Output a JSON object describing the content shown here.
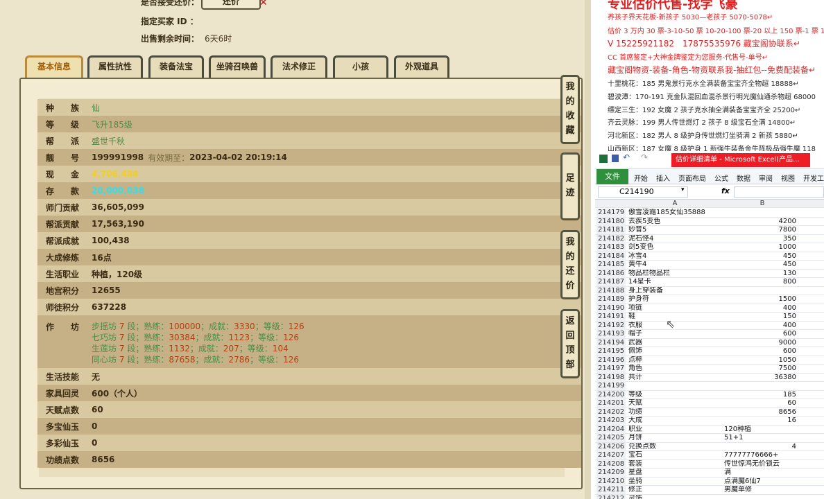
{
  "game": {
    "top": {
      "accept_counter_label": "是否接受还价：",
      "counter_button": "还价",
      "buyer_id_label": "指定买家 ID ：",
      "time_left_label": "出售剩余时间：",
      "time_left_value": "6天6时"
    },
    "tabs": [
      {
        "label": "基本信息",
        "active": true
      },
      {
        "label": "属性抗性",
        "active": false
      },
      {
        "label": "装备法宝",
        "active": false
      },
      {
        "label": "坐骑召唤兽",
        "active": false
      },
      {
        "label": "法术修正",
        "active": false
      },
      {
        "label": "小孩",
        "active": false
      },
      {
        "label": "外观道具",
        "active": false
      }
    ],
    "rows": [
      {
        "label": "种　　族",
        "value": "仙",
        "style": "g"
      },
      {
        "label": "等　　级",
        "value": "飞升185级",
        "style": "g"
      },
      {
        "label": "帮　　派",
        "value": "盛世千秋",
        "style": "g"
      },
      {
        "label": "靓　　号",
        "value": "199991998",
        "extra_label": "有效期至：",
        "extra_value": "2023-04-02 20:19:14",
        "style": ""
      },
      {
        "label": "现　　金",
        "value": "4,706,488",
        "style": "y"
      },
      {
        "label": "存　　款",
        "value": "20,000,038",
        "style": "c"
      },
      {
        "label": "师门贡献",
        "value": "36,605,099",
        "style": ""
      },
      {
        "label": "帮派贡献",
        "value": "17,563,190",
        "style": ""
      },
      {
        "label": "帮派成就",
        "value": "100,438",
        "style": ""
      },
      {
        "label": "大成修炼",
        "value": "16点",
        "style": ""
      },
      {
        "label": "生活职业",
        "value": "种植，120级",
        "style": ""
      },
      {
        "label": "地宫积分",
        "value": "12655",
        "style": ""
      },
      {
        "label": "师徒积分",
        "value": "637228",
        "style": ""
      }
    ],
    "workshop": {
      "label": "作　　坊",
      "lines": [
        {
          "name": "步摇坊",
          "grade": "7",
          "skill": "100000",
          "ach": "3330",
          "lvl": "126"
        },
        {
          "name": "七巧坊",
          "grade": "7",
          "skill": "30384",
          "ach": "1123",
          "lvl": "126"
        },
        {
          "name": "生莲坊",
          "grade": "7",
          "skill": "1132",
          "ach": "207",
          "lvl": "104"
        },
        {
          "name": "同心坊",
          "grade": "7",
          "skill": "87658",
          "ach": "2786",
          "lvl": "126"
        }
      ],
      "grade_word": "段；熟练：",
      "ach_word": "；成就：",
      "lvl_word": "；等级："
    },
    "rows2": [
      {
        "label": "生活技能",
        "value": "无"
      },
      {
        "label": "家具回灵",
        "value": "600（个人）"
      },
      {
        "label": "天赋点数",
        "value": "60"
      },
      {
        "label": "多宝仙玉",
        "value": "0"
      },
      {
        "label": "多彩仙玉",
        "value": "0"
      },
      {
        "label": "功绩点数",
        "value": "8656"
      }
    ],
    "side_buttons": [
      "我的收藏",
      "足迹",
      "我的还价",
      "返回顶部"
    ]
  },
  "ad": {
    "headline": "专业估价代售-找学飞豪",
    "lines": [
      {
        "text": "养孩子界天花板-新孩子 5030—老孩子 5070-5078↵",
        "style": "red"
      },
      {
        "text": "估价 3 万内 30 票-3-10-50 票 10-20-100 票-20 以上 150 票-1 票 1",
        "style": "red"
      },
      {
        "text": "V 15225921182　17875535976  藏宝阁协联系↵",
        "style": "red big"
      },
      {
        "text": "CC 首席鉴定+大神金牌鉴定为您服务-代售号-单号↵",
        "style": "red"
      },
      {
        "text": "藏宝阁物资-装备-角色-物资联系我-抽红包--免费配装备↵",
        "style": "red big"
      },
      {
        "text": "十里桃花：185 男鬼景行克水全满装备宝宝齐全物超 18888↵",
        "style": ""
      },
      {
        "text": "碧波潭：170-191 克金队混回血混杀景行明光魔仙通杀物超 68000",
        "style": ""
      },
      {
        "text": "缥定三生：192 女魔 2 孩子克水抽全满装备宝宝齐全 25200↵",
        "style": ""
      },
      {
        "text": "齐云灵脉：199 男人传世燃灯 2 孩子 8 级宝石全满 14800↵",
        "style": ""
      },
      {
        "text": "河北新区：182 男人 8 级护身传世燃灯坐骑满 2 新孩 5880↵",
        "style": ""
      },
      {
        "text": "山西新区：187 女魔 8 级护身 1 新强牛装备金牛阵极品强牛魔 118",
        "style": ""
      }
    ]
  },
  "excel": {
    "title": "估价详细清单 - Microsoft Excel(产品...",
    "ribbon_tabs": [
      "文件",
      "开始",
      "插入",
      "页面布局",
      "公式",
      "数据",
      "审阅",
      "视图",
      "开发工"
    ],
    "name_box": "C214190",
    "fx": "fx",
    "col_a": "A",
    "col_b": "B",
    "rows": [
      {
        "n": "214179",
        "a": "傲雪凌霜185女仙35888",
        "b": ""
      },
      {
        "n": "214180",
        "a": "去疾5变色",
        "b": "4200",
        "num": true
      },
      {
        "n": "214181",
        "a": "妙音5",
        "b": "7800",
        "num": true
      },
      {
        "n": "214182",
        "a": "泥石怪4",
        "b": "350",
        "num": true
      },
      {
        "n": "214183",
        "a": "剑5变色",
        "b": "1000",
        "num": true
      },
      {
        "n": "214184",
        "a": "冰雪4",
        "b": "450",
        "num": true
      },
      {
        "n": "214185",
        "a": "黄牛4",
        "b": "450",
        "num": true
      },
      {
        "n": "214186",
        "a": "物品栏物品栏",
        "b": "130",
        "num": true
      },
      {
        "n": "214187",
        "a": "14星卡",
        "b": "800",
        "num": true
      },
      {
        "n": "214188",
        "a": "身上穿装备",
        "b": ""
      },
      {
        "n": "214189",
        "a": "护身符",
        "b": "1500",
        "num": true
      },
      {
        "n": "214190",
        "a": "项链",
        "b": "400",
        "num": true
      },
      {
        "n": "214191",
        "a": "鞋",
        "b": "150",
        "num": true
      },
      {
        "n": "214192",
        "a": "衣服",
        "b": "400",
        "num": true
      },
      {
        "n": "214193",
        "a": "帽子",
        "b": "600",
        "num": true
      },
      {
        "n": "214194",
        "a": "武器",
        "b": "9000",
        "num": true
      },
      {
        "n": "214195",
        "a": "佩饰",
        "b": "600",
        "num": true
      },
      {
        "n": "214196",
        "a": "点粹",
        "b": "1050",
        "num": true
      },
      {
        "n": "214197",
        "a": "角色",
        "b": "7500",
        "num": true
      },
      {
        "n": "214198",
        "a": "共计",
        "b": "36380",
        "num": true
      },
      {
        "n": "214199",
        "a": "",
        "b": ""
      },
      {
        "n": "214200",
        "a": "等级",
        "b": "185",
        "num": true
      },
      {
        "n": "214201",
        "a": "天赋",
        "b": "60",
        "num": true
      },
      {
        "n": "214202",
        "a": "功绩",
        "b": "8656",
        "num": true
      },
      {
        "n": "214203",
        "a": "大成",
        "b": "16",
        "num": true
      },
      {
        "n": "214204",
        "a": "职业",
        "b": "120种植"
      },
      {
        "n": "214205",
        "a": "月饼",
        "b": "51+1"
      },
      {
        "n": "214206",
        "a": "兑换点数",
        "b": "4",
        "num": true
      },
      {
        "n": "214207",
        "a": "宝石",
        "b": "77777776666+"
      },
      {
        "n": "214208",
        "a": "套装",
        "b": "传世惊鸿无价锁云"
      },
      {
        "n": "214209",
        "a": "星盘",
        "b": "满"
      },
      {
        "n": "214210",
        "a": "坐骑",
        "b": "点满魔6仙7"
      },
      {
        "n": "214211",
        "a": "修正",
        "b": "男魔单修"
      },
      {
        "n": "214212",
        "a": "灵饰",
        "b": ""
      }
    ]
  }
}
